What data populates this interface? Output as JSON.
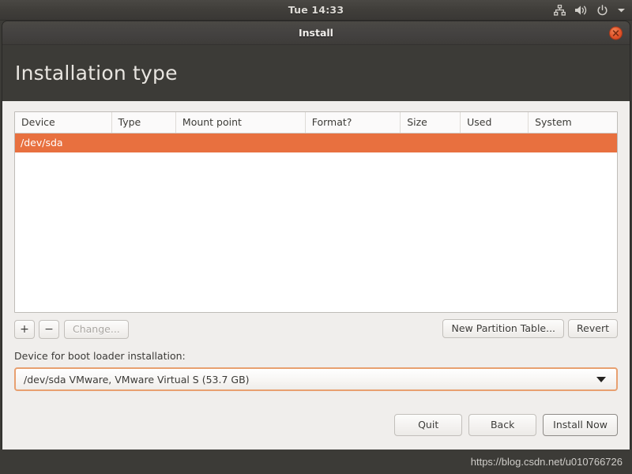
{
  "top_panel": {
    "clock": "Tue 14:33",
    "tray_icons": [
      "network-icon",
      "volume-icon",
      "power-icon",
      "chevron-down-icon"
    ]
  },
  "window": {
    "title": "Install",
    "close_label": "×"
  },
  "page": {
    "title": "Installation type"
  },
  "partition_table": {
    "columns": [
      "Device",
      "Type",
      "Mount point",
      "Format?",
      "Size",
      "Used",
      "System"
    ],
    "rows": [
      {
        "device": "/dev/sda",
        "type": "",
        "mount_point": "",
        "format": "",
        "size": "",
        "used": "",
        "system": "",
        "selected": true
      }
    ]
  },
  "table_toolbar": {
    "add_label": "+",
    "remove_label": "−",
    "change_label": "Change...",
    "new_partition_table_label": "New Partition Table...",
    "revert_label": "Revert"
  },
  "bootloader": {
    "label": "Device for boot loader installation:",
    "selected_value": "/dev/sda VMware, VMware Virtual S (53.7 GB)"
  },
  "footer": {
    "quit_label": "Quit",
    "back_label": "Back",
    "install_now_label": "Install Now"
  },
  "watermark": {
    "text": "https://blog.csdn.net/u010766726"
  },
  "colors": {
    "selection_orange": "#e8703f",
    "panel_dark": "#3c3b37",
    "content_bg": "#f0eeec",
    "combo_focus_border": "#e8a070",
    "close_button": "#e2542a"
  }
}
